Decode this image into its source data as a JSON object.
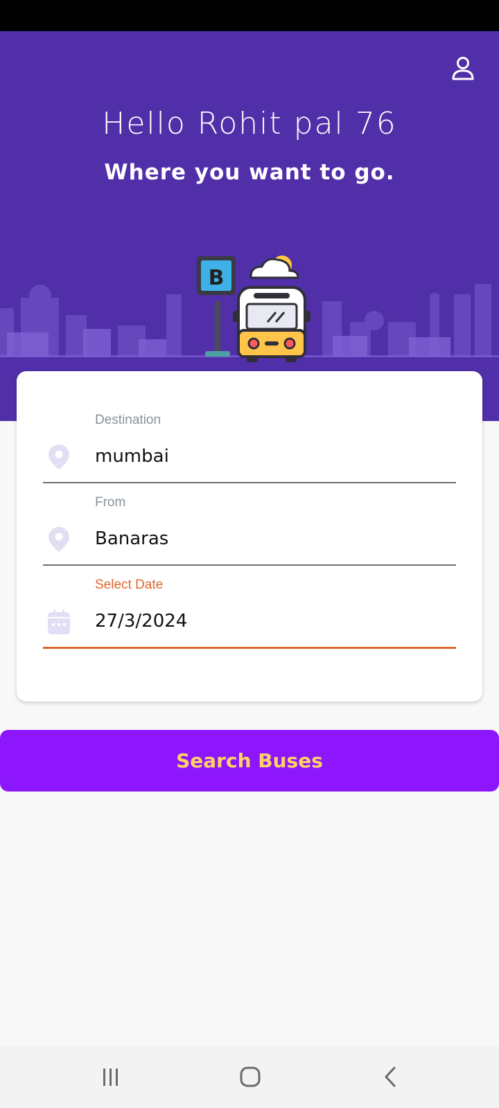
{
  "header": {
    "greeting": "Hello Rohit pal 76",
    "subtitle": "Where you want to go.",
    "bus_stop_letter": "B"
  },
  "form": {
    "destination": {
      "label": "Destination",
      "value": "mumbai"
    },
    "from": {
      "label": "From",
      "value": "Banaras"
    },
    "date": {
      "label": "Select Date",
      "value": "27/3/2024"
    }
  },
  "search_button": {
    "label": "Search Buses"
  },
  "icons": {
    "profile": "person-outline-icon",
    "destination": "location-pin-icon",
    "from": "location-pin-icon",
    "date": "calendar-icon",
    "nav_recent": "recent-apps-icon",
    "nav_home": "home-icon",
    "nav_back": "back-chevron-icon"
  },
  "colors": {
    "header_bg": "#512fa8",
    "accent_orange": "#e0662c",
    "button_bg": "#8d16fd",
    "button_text": "#ffd266"
  }
}
